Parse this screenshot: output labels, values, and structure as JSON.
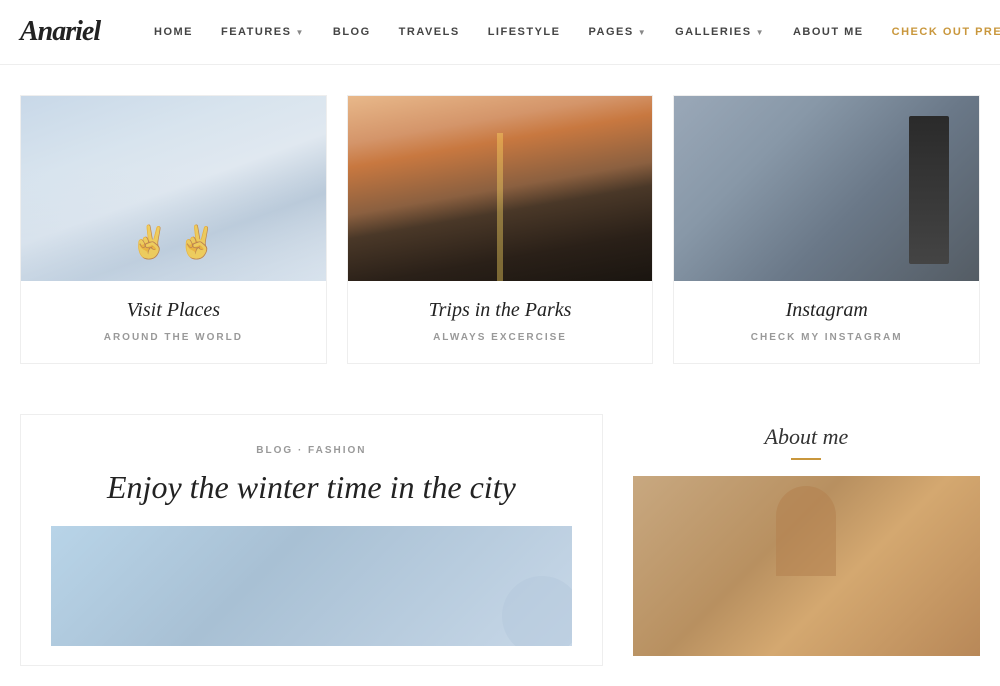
{
  "header": {
    "logo": "Anariel",
    "nav": {
      "items": [
        {
          "label": "HOME",
          "has_dropdown": false
        },
        {
          "label": "FEATURES",
          "has_dropdown": true
        },
        {
          "label": "BLOG",
          "has_dropdown": false
        },
        {
          "label": "TRAVELS",
          "has_dropdown": false
        },
        {
          "label": "LIFESTYLE",
          "has_dropdown": false
        },
        {
          "label": "PAGES",
          "has_dropdown": true
        },
        {
          "label": "GALLERIES",
          "has_dropdown": true
        },
        {
          "label": "ABOUT ME",
          "has_dropdown": false
        }
      ],
      "premium_label": "CHECK OUT PREMIUM VERSiON"
    }
  },
  "cards": [
    {
      "title": "Visit Places",
      "subtitle": "AROUND THE WORLD"
    },
    {
      "title": "Trips in the Parks",
      "subtitle": "ALWAYS EXCERCISE"
    },
    {
      "title": "Instagram",
      "subtitle": "CHECK MY INSTAGRAM"
    }
  ],
  "blog_post": {
    "categories": "BLOG · FASHION",
    "title": "Enjoy the winter time in the city"
  },
  "about_me": {
    "title": "About me"
  }
}
